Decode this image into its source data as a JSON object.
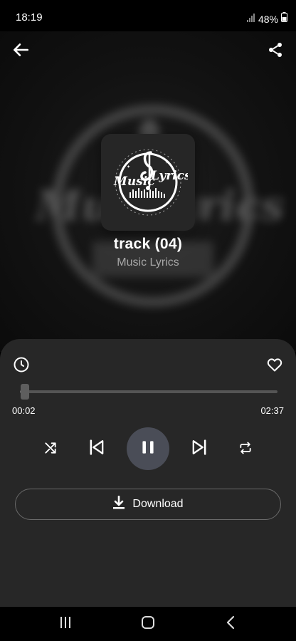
{
  "status_bar": {
    "time": "18:19",
    "battery": "48%",
    "icons": [
      "signal-icon",
      "battery-icon"
    ]
  },
  "header": {
    "back_icon": "arrow-left-icon",
    "share_icon": "share-icon"
  },
  "album_art": {
    "logo_line1": "Music",
    "logo_line2": "Lyrics"
  },
  "track": {
    "title": "track (04)",
    "artist": "Music Lyrics"
  },
  "player": {
    "timer_icon": "clock-icon",
    "favorite_icon": "heart-outline-icon",
    "current_time": "00:02",
    "total_time": "02:37",
    "progress_fraction": 0.013,
    "controls": [
      "shuffle-icon",
      "skip-previous-icon",
      "pause-icon",
      "skip-next-icon",
      "repeat-icon"
    ],
    "download_label": "Download",
    "download_icon": "download-icon"
  },
  "nav_bar": {
    "buttons": [
      "recents-icon",
      "home-icon",
      "back-icon"
    ]
  },
  "colors": {
    "background": "#000000",
    "sheet": "#272727",
    "play_button": "#4a4d57",
    "artist_text": "#a6a6a6"
  }
}
